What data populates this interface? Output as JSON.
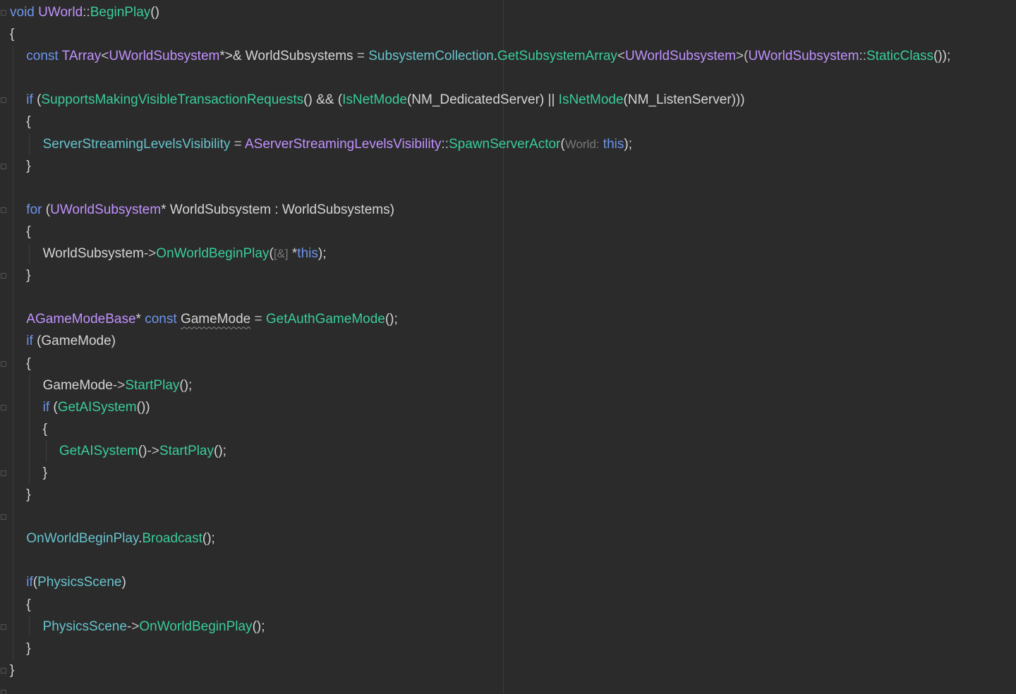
{
  "code_lines": [
    {
      "indent": 0,
      "tokens": [
        {
          "t": "void",
          "c": "kw"
        },
        {
          "t": " ",
          "c": "plain"
        },
        {
          "t": "UWorld",
          "c": "type"
        },
        {
          "t": "::",
          "c": "op"
        },
        {
          "t": "BeginPlay",
          "c": "fn"
        },
        {
          "t": "()",
          "c": "plain"
        }
      ]
    },
    {
      "indent": 0,
      "tokens": [
        {
          "t": "{",
          "c": "plain"
        }
      ]
    },
    {
      "indent": 1,
      "tokens": [
        {
          "t": "const",
          "c": "kw"
        },
        {
          "t": " ",
          "c": "plain"
        },
        {
          "t": "TArray",
          "c": "type"
        },
        {
          "t": "<",
          "c": "op"
        },
        {
          "t": "UWorldSubsystem",
          "c": "type"
        },
        {
          "t": "*>& ",
          "c": "plain"
        },
        {
          "t": "WorldSubsystems",
          "c": "plain"
        },
        {
          "t": " = ",
          "c": "op"
        },
        {
          "t": "SubsystemCollection",
          "c": "prop"
        },
        {
          "t": ".",
          "c": "plain"
        },
        {
          "t": "GetSubsystemArray",
          "c": "fn"
        },
        {
          "t": "<",
          "c": "op"
        },
        {
          "t": "UWorldSubsystem",
          "c": "type"
        },
        {
          "t": ">(",
          "c": "op"
        },
        {
          "t": "UWorldSubsystem",
          "c": "type"
        },
        {
          "t": "::",
          "c": "op"
        },
        {
          "t": "StaticClass",
          "c": "fn"
        },
        {
          "t": "());",
          "c": "plain"
        }
      ]
    },
    {
      "indent": 1,
      "tokens": []
    },
    {
      "indent": 1,
      "tokens": [
        {
          "t": "if",
          "c": "kw"
        },
        {
          "t": " (",
          "c": "plain"
        },
        {
          "t": "SupportsMakingVisibleTransactionRequests",
          "c": "fn"
        },
        {
          "t": "() && (",
          "c": "plain"
        },
        {
          "t": "IsNetMode",
          "c": "fn"
        },
        {
          "t": "(",
          "c": "plain"
        },
        {
          "t": "NM_DedicatedServer",
          "c": "plain"
        },
        {
          "t": ") || ",
          "c": "plain"
        },
        {
          "t": "IsNetMode",
          "c": "fn"
        },
        {
          "t": "(",
          "c": "plain"
        },
        {
          "t": "NM_ListenServer",
          "c": "plain"
        },
        {
          "t": ")))",
          "c": "plain"
        }
      ]
    },
    {
      "indent": 1,
      "tokens": [
        {
          "t": "{",
          "c": "plain"
        }
      ]
    },
    {
      "indent": 2,
      "tokens": [
        {
          "t": "ServerStreamingLevelsVisibility",
          "c": "prop"
        },
        {
          "t": " = ",
          "c": "op"
        },
        {
          "t": "AServerStreamingLevelsVisibility",
          "c": "type"
        },
        {
          "t": "::",
          "c": "op"
        },
        {
          "t": "SpawnServerActor",
          "c": "fn"
        },
        {
          "t": "(",
          "c": "plain"
        },
        {
          "t": "World:",
          "c": "hint"
        },
        {
          "t": " ",
          "c": "plain"
        },
        {
          "t": "this",
          "c": "kw"
        },
        {
          "t": ");",
          "c": "plain"
        }
      ]
    },
    {
      "indent": 1,
      "tokens": [
        {
          "t": "}",
          "c": "plain"
        }
      ]
    },
    {
      "indent": 1,
      "tokens": []
    },
    {
      "indent": 1,
      "tokens": [
        {
          "t": "for",
          "c": "kw"
        },
        {
          "t": " (",
          "c": "plain"
        },
        {
          "t": "UWorldSubsystem",
          "c": "type"
        },
        {
          "t": "* WorldSubsystem : WorldSubsystems)",
          "c": "plain"
        }
      ]
    },
    {
      "indent": 1,
      "tokens": [
        {
          "t": "{",
          "c": "plain"
        }
      ]
    },
    {
      "indent": 2,
      "tokens": [
        {
          "t": "WorldSubsystem",
          "c": "plain"
        },
        {
          "t": "->",
          "c": "op"
        },
        {
          "t": "OnWorldBeginPlay",
          "c": "fn"
        },
        {
          "t": "(",
          "c": "plain"
        },
        {
          "t": "[&]",
          "c": "hint"
        },
        {
          "t": " *",
          "c": "plain"
        },
        {
          "t": "this",
          "c": "kw"
        },
        {
          "t": ");",
          "c": "plain"
        }
      ]
    },
    {
      "indent": 1,
      "tokens": [
        {
          "t": "}",
          "c": "plain"
        }
      ]
    },
    {
      "indent": 1,
      "tokens": []
    },
    {
      "indent": 1,
      "tokens": [
        {
          "t": "AGameModeBase",
          "c": "type"
        },
        {
          "t": "* ",
          "c": "plain"
        },
        {
          "t": "const",
          "c": "kw"
        },
        {
          "t": " ",
          "c": "plain"
        },
        {
          "t": "GameMode",
          "c": "plain wavy"
        },
        {
          "t": " = ",
          "c": "op"
        },
        {
          "t": "GetAuthGameMode",
          "c": "fn"
        },
        {
          "t": "();",
          "c": "plain"
        }
      ]
    },
    {
      "indent": 1,
      "tokens": [
        {
          "t": "if",
          "c": "kw"
        },
        {
          "t": " (GameMode)",
          "c": "plain"
        }
      ]
    },
    {
      "indent": 1,
      "tokens": [
        {
          "t": "{",
          "c": "plain"
        }
      ]
    },
    {
      "indent": 2,
      "tokens": [
        {
          "t": "GameMode",
          "c": "plain"
        },
        {
          "t": "->",
          "c": "op"
        },
        {
          "t": "StartPlay",
          "c": "fn"
        },
        {
          "t": "();",
          "c": "plain"
        }
      ]
    },
    {
      "indent": 2,
      "tokens": [
        {
          "t": "if",
          "c": "kw"
        },
        {
          "t": " (",
          "c": "plain"
        },
        {
          "t": "GetAISystem",
          "c": "fn"
        },
        {
          "t": "())",
          "c": "plain"
        }
      ]
    },
    {
      "indent": 2,
      "tokens": [
        {
          "t": "{",
          "c": "plain"
        }
      ]
    },
    {
      "indent": 3,
      "tokens": [
        {
          "t": "GetAISystem",
          "c": "fn"
        },
        {
          "t": "()",
          "c": "plain"
        },
        {
          "t": "->",
          "c": "op"
        },
        {
          "t": "StartPlay",
          "c": "fn"
        },
        {
          "t": "();",
          "c": "plain"
        }
      ]
    },
    {
      "indent": 2,
      "tokens": [
        {
          "t": "}",
          "c": "plain"
        }
      ]
    },
    {
      "indent": 1,
      "tokens": [
        {
          "t": "}",
          "c": "plain"
        }
      ]
    },
    {
      "indent": 1,
      "tokens": []
    },
    {
      "indent": 1,
      "tokens": [
        {
          "t": "OnWorldBeginPlay",
          "c": "prop"
        },
        {
          "t": ".",
          "c": "plain"
        },
        {
          "t": "Broadcast",
          "c": "fn"
        },
        {
          "t": "();",
          "c": "plain"
        }
      ]
    },
    {
      "indent": 1,
      "tokens": []
    },
    {
      "indent": 1,
      "tokens": [
        {
          "t": "if",
          "c": "kw"
        },
        {
          "t": "(",
          "c": "plain"
        },
        {
          "t": "PhysicsScene",
          "c": "prop"
        },
        {
          "t": ")",
          "c": "plain"
        }
      ]
    },
    {
      "indent": 1,
      "tokens": [
        {
          "t": "{",
          "c": "plain"
        }
      ]
    },
    {
      "indent": 2,
      "tokens": [
        {
          "t": "PhysicsScene",
          "c": "prop"
        },
        {
          "t": "->",
          "c": "op"
        },
        {
          "t": "OnWorldBeginPlay",
          "c": "fn"
        },
        {
          "t": "();",
          "c": "plain"
        }
      ]
    },
    {
      "indent": 1,
      "tokens": [
        {
          "t": "}",
          "c": "plain"
        }
      ]
    },
    {
      "indent": 0,
      "tokens": [
        {
          "t": "}",
          "c": "plain"
        }
      ]
    }
  ],
  "fold_marker_lines": [
    0,
    4,
    7,
    9,
    12,
    16,
    18,
    21,
    23,
    28,
    30,
    31
  ],
  "colors": {
    "background": "#2b2b2b",
    "keyword": "#6c95eb",
    "type": "#c191ff",
    "function": "#39cc9b",
    "field": "#66c3cc",
    "text": "#d4d4d4",
    "hint": "#787878"
  }
}
